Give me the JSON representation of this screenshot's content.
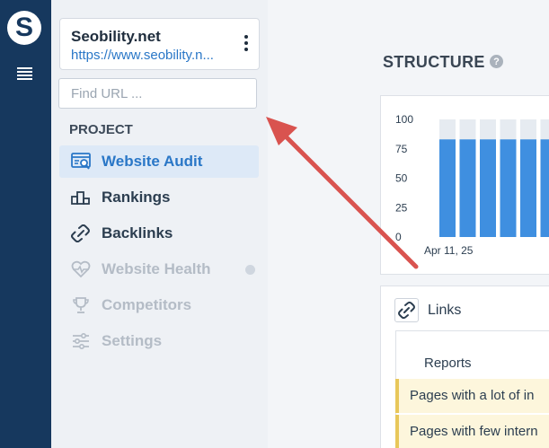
{
  "rail": {
    "logo_letter": "S",
    "menu_icon": "hamburger-menu-icon"
  },
  "project": {
    "name": "Seobility.net",
    "url": "https://www.seobility.n..."
  },
  "search": {
    "placeholder": "Find URL ...",
    "value": ""
  },
  "nav": {
    "section_label": "PROJECT",
    "items": [
      {
        "label": "Website Audit",
        "icon": "website-audit-icon",
        "state": "active"
      },
      {
        "label": "Rankings",
        "icon": "rankings-icon",
        "state": "normal"
      },
      {
        "label": "Backlinks",
        "icon": "backlinks-icon",
        "state": "normal"
      },
      {
        "label": "Website Health",
        "icon": "heart-pulse-icon",
        "state": "disabled"
      },
      {
        "label": "Competitors",
        "icon": "trophy-icon",
        "state": "disabled"
      },
      {
        "label": "Settings",
        "icon": "sliders-icon",
        "state": "disabled"
      }
    ]
  },
  "structure": {
    "title": "STRUCTURE",
    "help_icon": "?",
    "chart_data": {
      "type": "bar",
      "yticks": [
        "100",
        "75",
        "50",
        "25",
        "0"
      ],
      "ylim": [
        0,
        100
      ],
      "xtick": "Apr 11, 25",
      "values": [
        83,
        83,
        83,
        83,
        83,
        83,
        83,
        83
      ],
      "background_values": [
        100,
        100,
        100,
        100,
        100,
        100,
        100,
        100
      ],
      "colors": {
        "bar": "#3f8fe0",
        "background": "#e6ebf1"
      }
    }
  },
  "links": {
    "title": "Links",
    "reports_header": "Reports",
    "rows": [
      "Pages with a lot of in",
      "Pages with few intern"
    ]
  },
  "annotation": {
    "arrow_color": "#d9534f"
  },
  "colors": {
    "rail": "#16385e",
    "accent": "#2a77c7",
    "active_bg": "#dde9f7"
  }
}
